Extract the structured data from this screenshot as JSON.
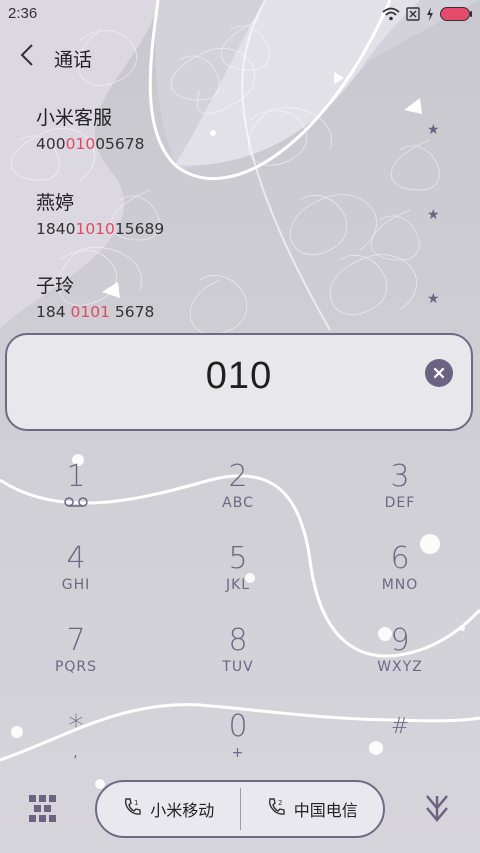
{
  "status_bar": {
    "time": "2:36",
    "battery_color": "#e84a6d"
  },
  "header": {
    "title": "通话",
    "back_icon": "chevron-left-icon"
  },
  "contacts": [
    {
      "name": "小米客服",
      "num_pre": "400",
      "num_hl": "010",
      "num_post": "05678"
    },
    {
      "name": "燕婷",
      "num_pre": "1840",
      "num_hl": "1010",
      "num_post": "15689"
    },
    {
      "name": "子玲",
      "num_pre": "184 ",
      "num_hl": "0101",
      "num_post": " 5678"
    }
  ],
  "dial_input": {
    "value": "010",
    "clear_icon": "clear-icon"
  },
  "keypad": [
    {
      "digit": "1",
      "letters": "",
      "icon": "voicemail-icon"
    },
    {
      "digit": "2",
      "letters": "ABC"
    },
    {
      "digit": "3",
      "letters": "DEF"
    },
    {
      "digit": "4",
      "letters": "GHI"
    },
    {
      "digit": "5",
      "letters": "JKL"
    },
    {
      "digit": "6",
      "letters": "MNO"
    },
    {
      "digit": "7",
      "letters": "PQRS"
    },
    {
      "digit": "8",
      "letters": "TUV"
    },
    {
      "digit": "9",
      "letters": "WXYZ"
    },
    {
      "digit": "*",
      "letters": ","
    },
    {
      "digit": "0",
      "letters": "+"
    },
    {
      "digit": "#",
      "letters": ""
    }
  ],
  "bottom_bar": {
    "sim1_label": "小米移动",
    "sim2_label": "中国电信",
    "left_icon": "qr-grid-icon",
    "right_icon": "hide-keypad-icon"
  },
  "colors": {
    "accent": "#e04a63",
    "ink": "#6c6884",
    "border": "#6e6a86"
  }
}
